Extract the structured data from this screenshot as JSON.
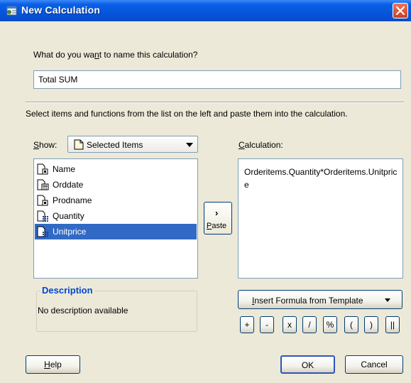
{
  "window": {
    "title": "New Calculation"
  },
  "name_section": {
    "prompt_pre": "What do you wa",
    "prompt_mnemonic": "n",
    "prompt_post": "t to name this calculation?",
    "value": "Total SUM"
  },
  "instructions": "Select items and functions from the list on the left and paste them into the calculation.",
  "show": {
    "label_mnemonic": "S",
    "label_rest": "how:",
    "selected": "Selected Items"
  },
  "items": [
    {
      "label": "Name",
      "icon": "text-item-icon",
      "selected": false
    },
    {
      "label": "Orddate",
      "icon": "date-item-icon",
      "selected": false
    },
    {
      "label": "Prodname",
      "icon": "text-item-icon",
      "selected": false
    },
    {
      "label": "Quantity",
      "icon": "numeric-item-icon",
      "selected": false
    },
    {
      "label": "Unitprice",
      "icon": "numeric-item-icon",
      "selected": true
    }
  ],
  "paste_button": {
    "mnemonic": "P",
    "rest": "aste"
  },
  "calculation": {
    "label_mnemonic": "C",
    "label_rest": "alculation:",
    "value": "Orderitems.Quantity*Orderitems.Unitprice"
  },
  "description": {
    "title": "Description",
    "text": "No description available"
  },
  "formula_button": {
    "mnemonic": "I",
    "rest": "nsert Formula from Template"
  },
  "operators": [
    "+",
    "-",
    "x",
    "/",
    "%",
    "(",
    ")",
    "||"
  ],
  "buttons": {
    "help_mnemonic": "H",
    "help_rest": "elp",
    "ok": "OK",
    "cancel": "Cancel"
  },
  "colors": {
    "titlebar": "#0453d8",
    "dialog_bg": "#ece9d8",
    "selection": "#316ac5",
    "description_title": "#0046d5"
  }
}
